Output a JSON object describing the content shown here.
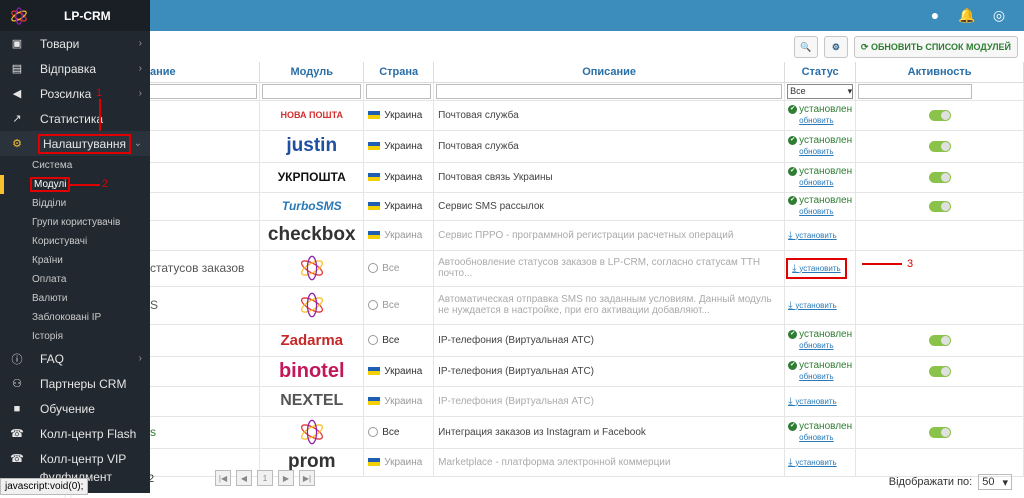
{
  "brand": {
    "name": "LP-CRM"
  },
  "sidebar": {
    "items": [
      {
        "label": "Товари",
        "icon": "box-icon",
        "chev": "›"
      },
      {
        "label": "Відправка",
        "icon": "truck-icon",
        "chev": "›"
      },
      {
        "label": "Розсилка",
        "icon": "megaphone-icon",
        "chev": "›"
      },
      {
        "label": "Статистика",
        "icon": "chart-icon",
        "chev": ""
      },
      {
        "label": "Налаштування",
        "icon": "gear-icon",
        "chev": "⌄"
      }
    ],
    "submenu": [
      "Система",
      "Модулі",
      "Відділи",
      "Групи користувачів",
      "Користувачі",
      "Країни",
      "Оплата",
      "Валюти",
      "Заблоковані IP",
      "Історія"
    ],
    "bottom": [
      {
        "label": "FAQ",
        "icon": "info-icon",
        "chev": "›"
      },
      {
        "label": "Партнеры CRM",
        "icon": "handshake-icon",
        "chev": ""
      },
      {
        "label": "Обучение",
        "icon": "video-icon",
        "chev": ""
      },
      {
        "label": "Колл-центр Flash",
        "icon": "phone-icon",
        "chev": ""
      },
      {
        "label": "Колл-центр VIP",
        "icon": "phone-icon",
        "chev": ""
      },
      {
        "label": "Фулфилмент склада",
        "icon": "warehouse-icon",
        "chev": ""
      }
    ]
  },
  "toolbar": {
    "refresh_label": "ОБНОВИТЬ СПИСОК МОДУЛЕЙ"
  },
  "table": {
    "headers": {
      "name": "ание",
      "module": "Модуль",
      "country": "Страна",
      "description": "Описание",
      "status": "Статус",
      "activity": "Активность"
    },
    "status_filter": "Все",
    "rows": [
      {
        "name": "",
        "logo": "НОВА ПОШТА",
        "country": "Украина",
        "desc": "Почтовая служба",
        "state": "installed"
      },
      {
        "name": "",
        "logo": "justin",
        "country": "Украина",
        "desc": "Почтовая служба",
        "state": "installed"
      },
      {
        "name": "",
        "logo": "УКРПОШТА",
        "country": "Украина",
        "desc": "Почтовая связь Украины",
        "state": "installed"
      },
      {
        "name": "",
        "logo": "TurboSMS",
        "country": "Украина",
        "desc": "Сервис SMS рассылок",
        "state": "installed"
      },
      {
        "name": "",
        "logo": "checkbox",
        "country": "Украина",
        "desc": "Сервис ПРРО - программной регистрации расчетных операций",
        "state": "install"
      },
      {
        "name": "статусов заказов",
        "logo": "",
        "country": "Все",
        "desc": "Автообновление статусов заказов в LP-CRM, согласно статусам ТТН почто...",
        "state": "install"
      },
      {
        "name": "S",
        "logo": "",
        "country": "Все",
        "desc": "Автоматическая отправка SMS по заданным условиям. Данный модуль не нуждается в настройке, при его активации добавляют...",
        "state": "install"
      },
      {
        "name": "",
        "logo": "Zadarma",
        "country": "Все",
        "desc": "IP-телефония (Виртуальная АТС)",
        "state": "installed"
      },
      {
        "name": "",
        "logo": "binotel",
        "country": "Украина",
        "desc": "IP-телефония (Виртуальная АТС)",
        "state": "installed"
      },
      {
        "name": "",
        "logo": "NEXTEL",
        "country": "Украина",
        "desc": "IP-телефония (Виртуальная АТС)",
        "state": "install"
      },
      {
        "name": "s",
        "logo": "",
        "country": "Все",
        "desc": "Интеграция заказов из Instagram и Facebook",
        "state": "installed"
      },
      {
        "name": "",
        "logo": "prom",
        "country": "Украина",
        "desc": "Marketplace - платформа электронной коммерции",
        "state": "install"
      }
    ]
  },
  "labels": {
    "installed": "установлен",
    "update": "обновить",
    "install": "установить"
  },
  "annotations": {
    "one": "1",
    "two": "2",
    "three": "3"
  },
  "pager": {
    "page": "1",
    "count_partial": "2"
  },
  "perpage": {
    "label": "Відображати по:",
    "value": "50"
  },
  "statusbar": {
    "text": "javascript:void(0);"
  },
  "colors": {
    "topbar": "#3c8dbc",
    "sidebar": "#212830",
    "accent_green": "#2e7d32",
    "link": "#2a7ab8",
    "annotation": "#e00000"
  }
}
